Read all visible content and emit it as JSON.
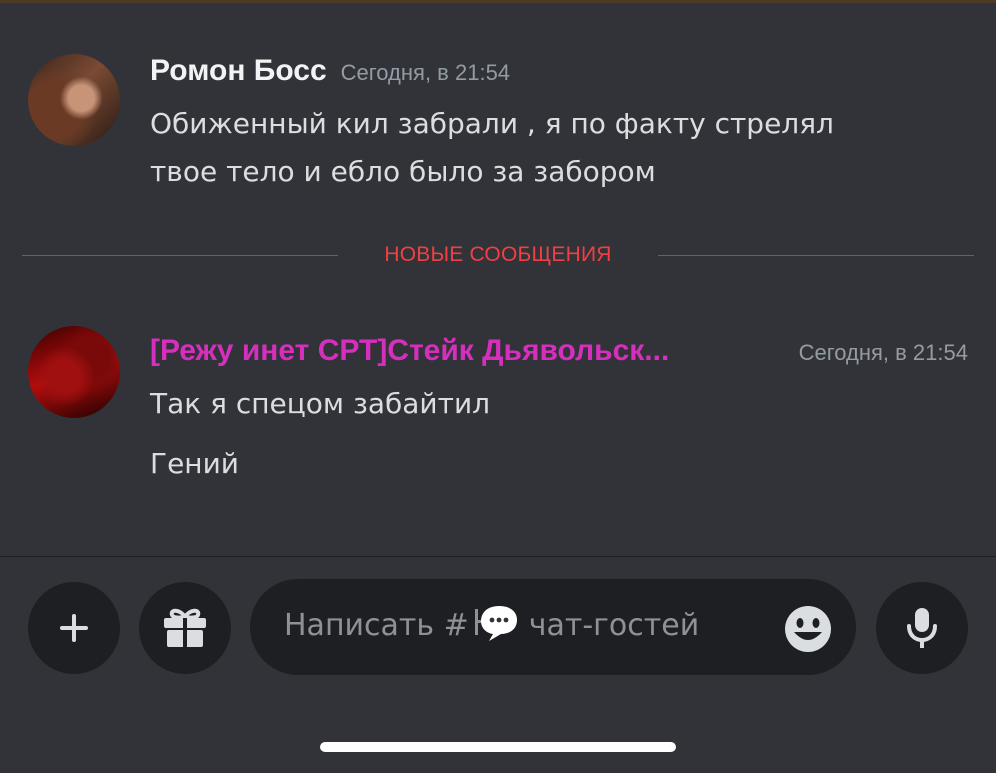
{
  "messages": [
    {
      "author": "Ромон Босс",
      "timestamp": "Сегодня, в 21:54",
      "lines": [
        "Обиженный кил забрали , я по факту стрелял",
        "твое тело и ебло было за забором"
      ]
    },
    {
      "author": "[Режу инет СРТ]Стейк Дьявольск...",
      "author_color": "#d62fbe",
      "timestamp": "Сегодня, в 21:54",
      "lines": [
        "Так я спецом забайтил",
        "Гений"
      ]
    }
  ],
  "divider": {
    "label": "НОВЫЕ СООБЩЕНИЯ",
    "color": "#f23f43"
  },
  "composer": {
    "placeholder_prefix": "Написать #",
    "channel_name": "чат-гостей",
    "add_icon": "plus-icon",
    "gift_icon": "gift-icon",
    "emoji_icon": "emoji-icon",
    "mic_icon": "microphone-icon"
  }
}
